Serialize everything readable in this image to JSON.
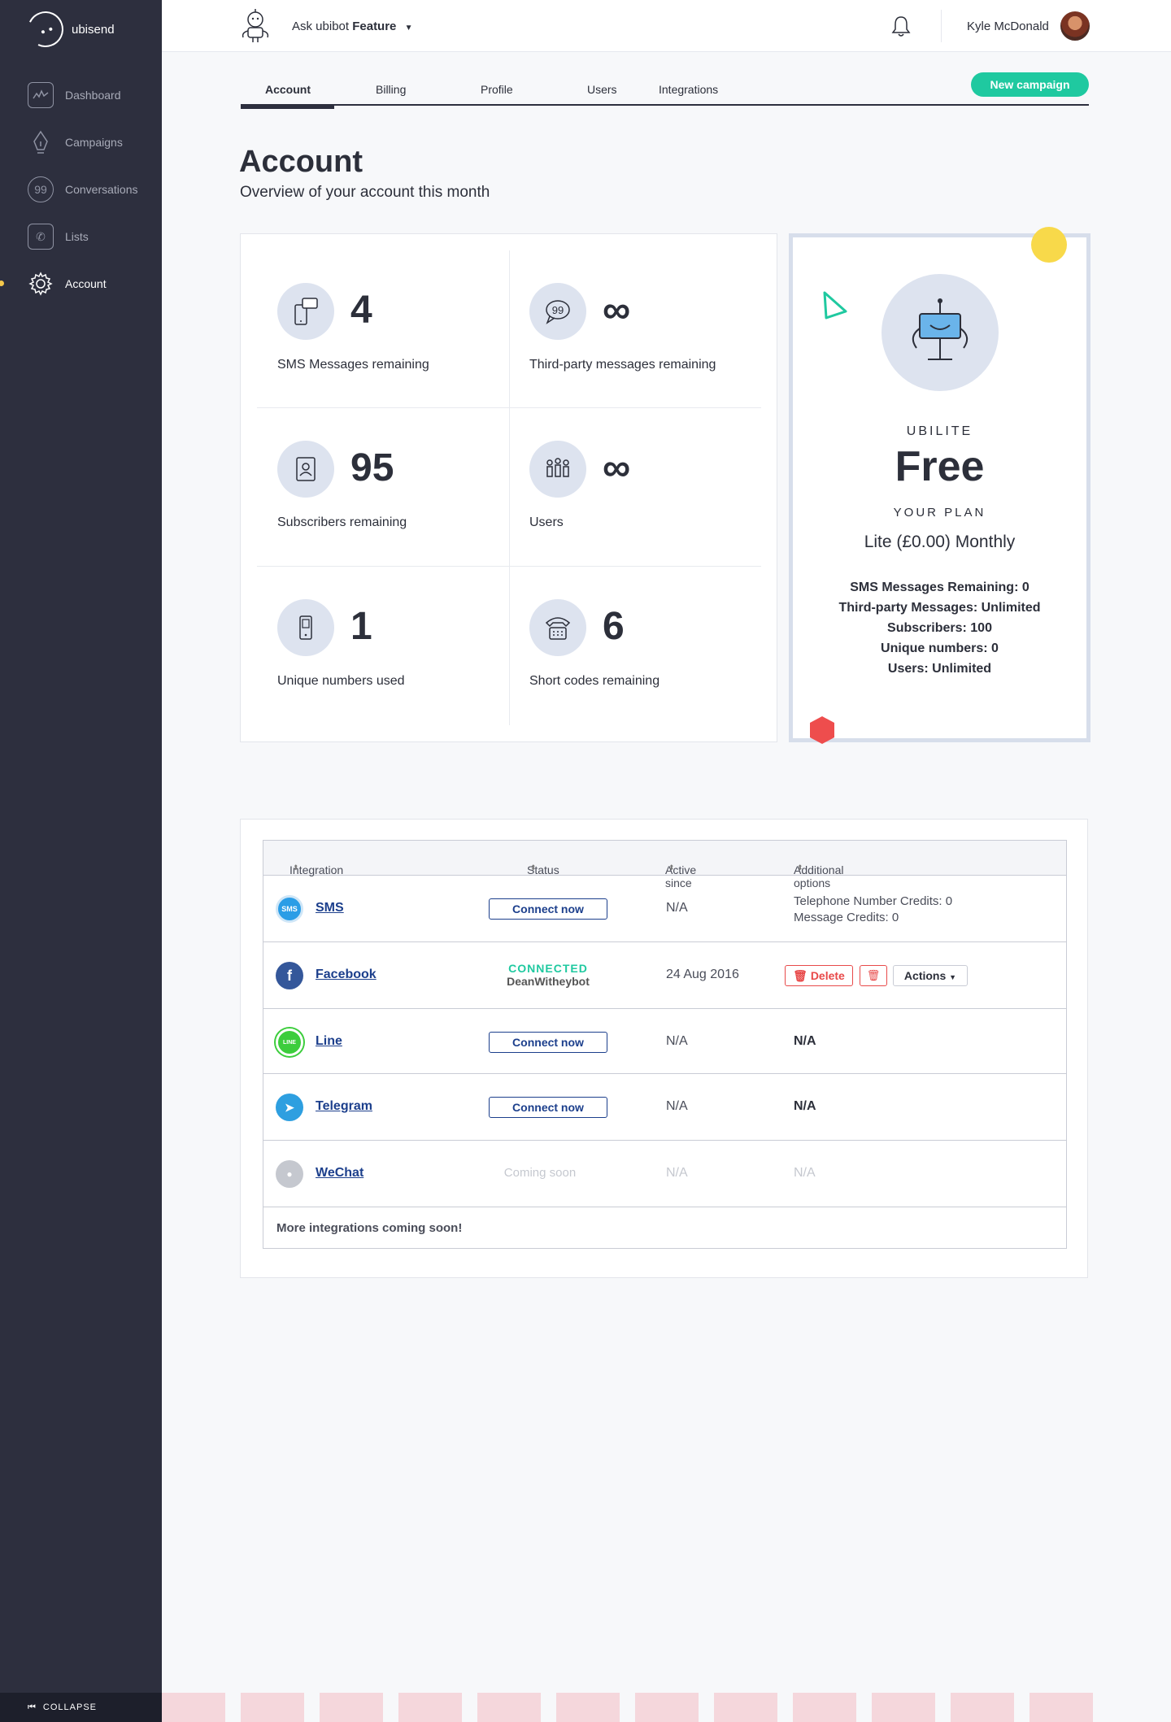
{
  "brand": {
    "name": "ubisend"
  },
  "sidebar": {
    "items": [
      {
        "label": "Dashboard",
        "icon": "chart-icon"
      },
      {
        "label": "Campaigns",
        "icon": "pen-icon"
      },
      {
        "label": "Conversations",
        "icon": "chat-icon"
      },
      {
        "label": "Lists",
        "icon": "phone-book-icon"
      },
      {
        "label": "Account",
        "icon": "gear-icon"
      }
    ],
    "collapse_label": "COLLAPSE"
  },
  "topbar": {
    "ask_prefix": "Ask ubibot",
    "ask_feature": "Feature",
    "user_name": "Kyle McDonald"
  },
  "tabs": [
    "Account",
    "Billing",
    "Profile",
    "Users",
    "Integrations"
  ],
  "new_campaign_label": "New campaign",
  "page": {
    "title": "Account",
    "subtitle": "Overview of your account this month"
  },
  "stats": [
    {
      "value": "4",
      "label": "SMS Messages remaining",
      "icon": "sms-phone-icon"
    },
    {
      "value": "∞",
      "label": "Third-party messages remaining",
      "icon": "quote-bubble-icon"
    },
    {
      "value": "95",
      "label": "Subscribers remaining",
      "icon": "address-book-icon"
    },
    {
      "value": "∞",
      "label": "Users",
      "icon": "users-icon"
    },
    {
      "value": "1",
      "label": "Unique numbers used",
      "icon": "mobile-icon"
    },
    {
      "value": "6",
      "label": "Short codes remaining",
      "icon": "telephone-icon"
    }
  ],
  "plan": {
    "brand": "UBILITE",
    "price": "Free",
    "your_plan_label": "YOUR PLAN",
    "name": "Lite (£0.00) Monthly",
    "details": [
      "SMS Messages Remaining: 0",
      "Third-party Messages: Unlimited",
      "Subscribers: 100",
      "Unique numbers: 0",
      "Users: Unlimited"
    ]
  },
  "integrations": {
    "headers": [
      "Integration",
      "Status",
      "Active since",
      "Additional options"
    ],
    "connect_label": "Connect now",
    "rows": [
      {
        "name": "SMS",
        "icon_text": "SMS",
        "active_since": "N/A",
        "extra_lines": [
          "Telephone Number Credits: 0",
          "Message Credits: 0"
        ]
      },
      {
        "name": "Facebook",
        "icon_text": "f",
        "status": "CONNECTED",
        "account": "DeanWitheybot",
        "active_since": "24 Aug 2016",
        "delete_label": "Delete",
        "actions_label": "Actions"
      },
      {
        "name": "Line",
        "icon_text": "LINE",
        "active_since": "N/A",
        "extra": "N/A"
      },
      {
        "name": "Telegram",
        "icon_text": "➤",
        "active_since": "N/A",
        "extra": "N/A"
      },
      {
        "name": "WeChat",
        "icon_text": "●",
        "status": "Coming soon",
        "active_since": "N/A",
        "extra": "N/A"
      }
    ],
    "footer": "More integrations coming soon!"
  },
  "colors": {
    "sidebar_bg": "#2d2f3e",
    "accent_green": "#1fc9a0",
    "link_blue": "#1c3f8c",
    "danger_red": "#e84a4a",
    "deco_yellow": "#f8d94a"
  }
}
